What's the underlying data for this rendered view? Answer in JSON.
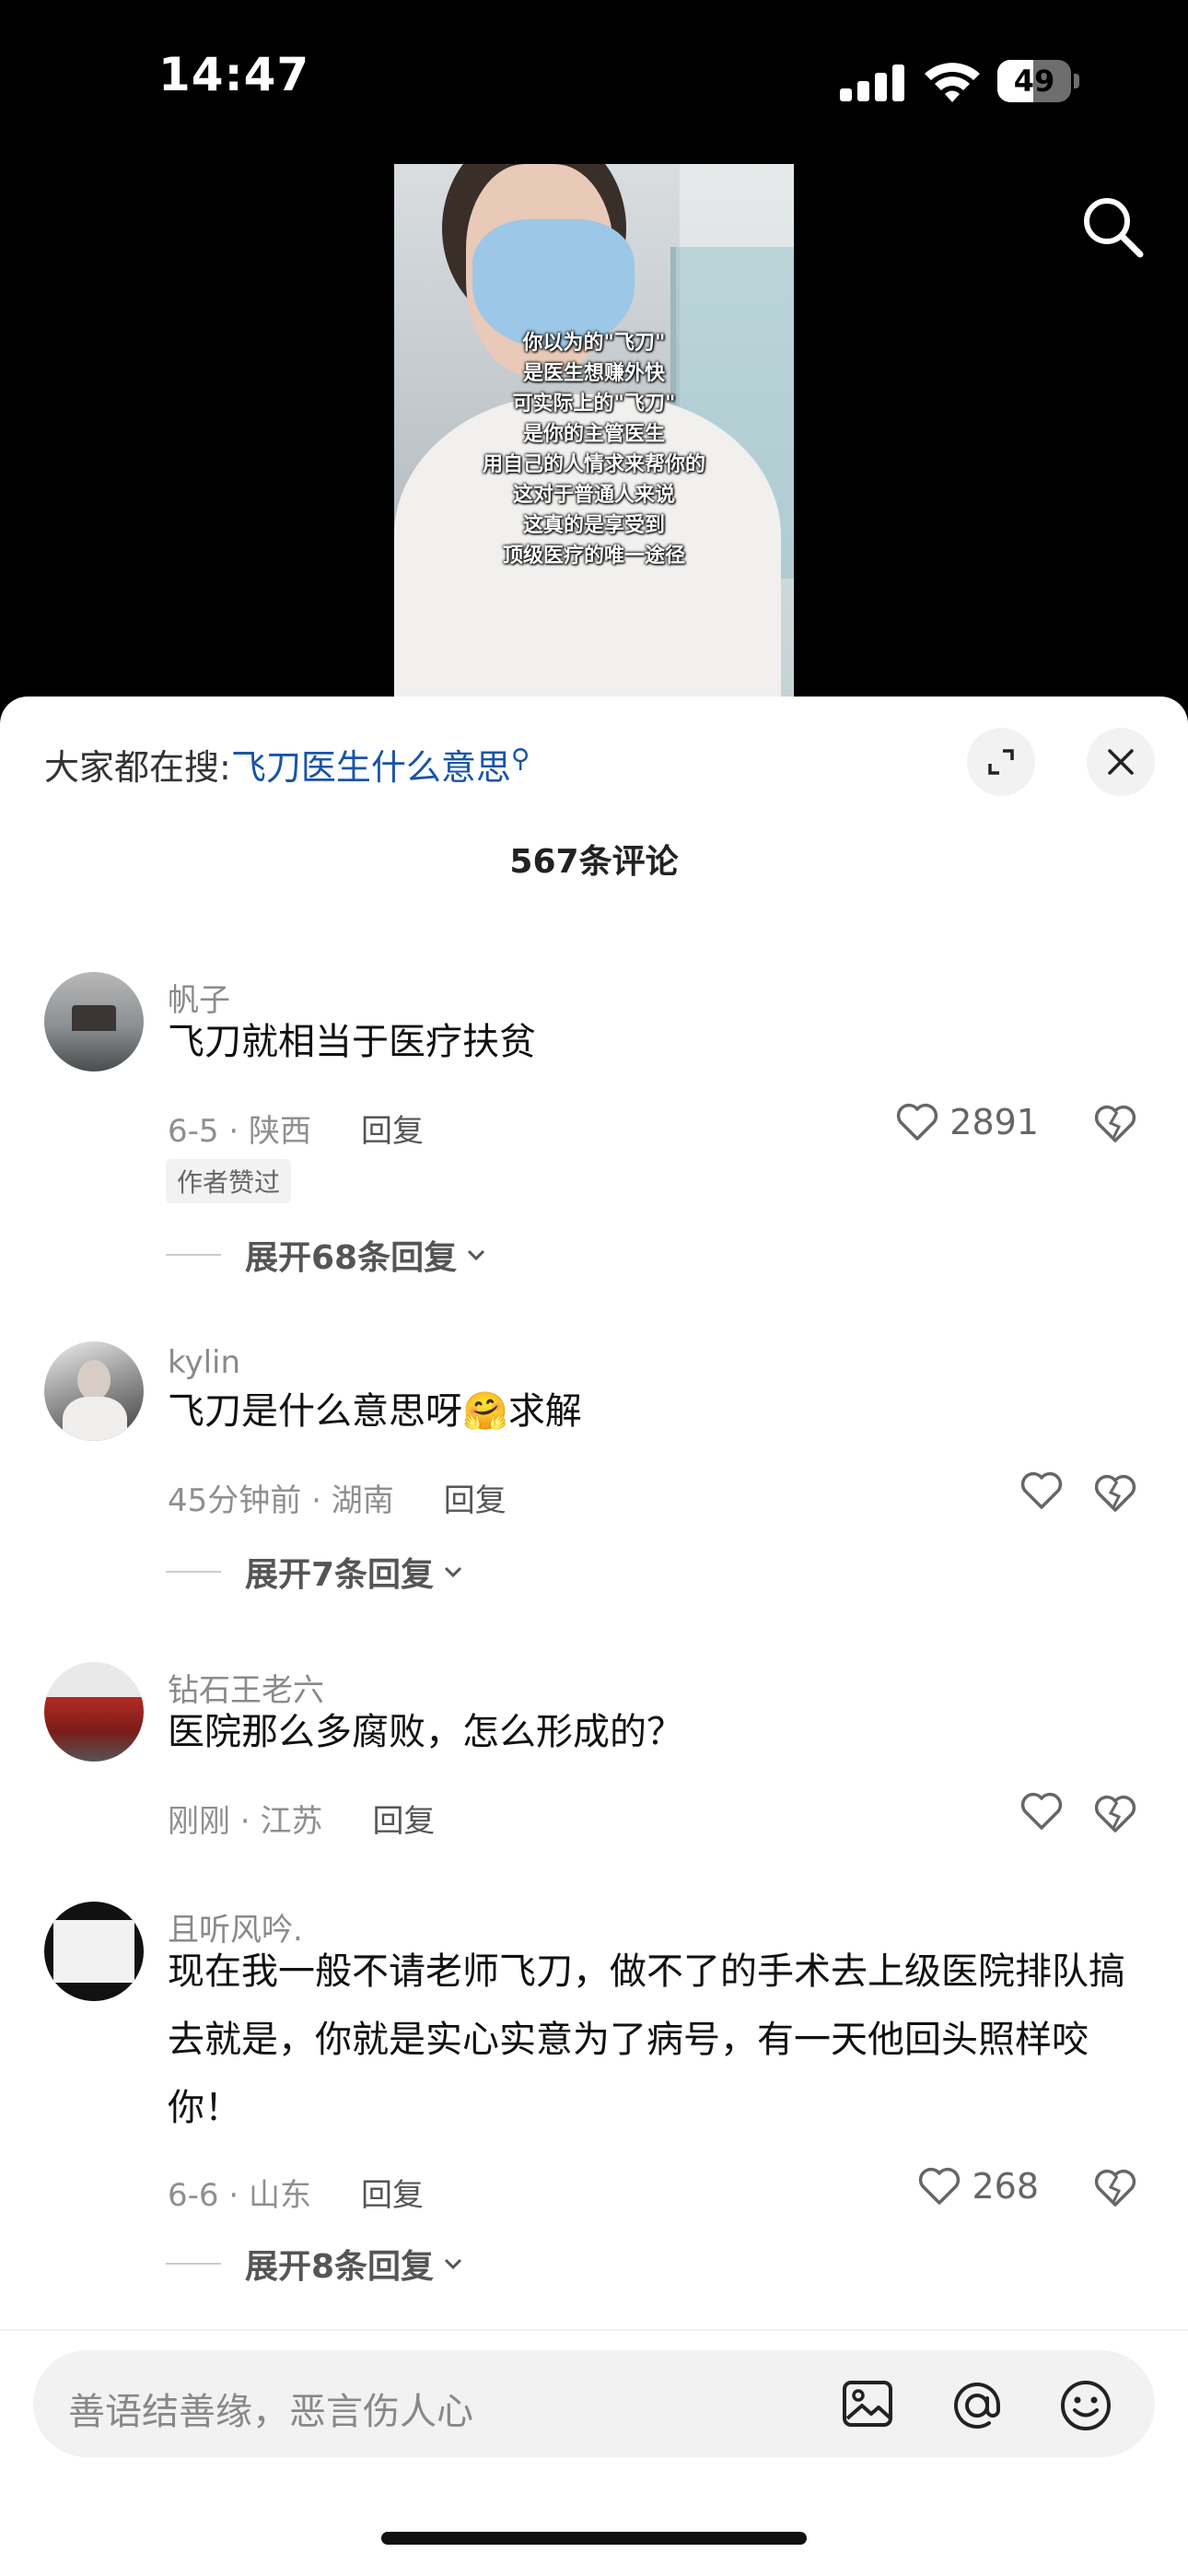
{
  "status_bar": {
    "time": "14:47",
    "battery": "49",
    "battery_level": 0.49
  },
  "video": {
    "caption_lines": [
      "你以为的\"飞刀\"",
      "是医生想赚外快",
      "可实际上的\"飞刀\"",
      "是你的主管医生",
      "用自己的人情求来帮你的",
      "这对于普通人来说",
      "这真的是享受到",
      "顶级医疗的唯一途径"
    ]
  },
  "comments_panel": {
    "hot_search_prefix": "大家都在搜:",
    "hot_search_term": "飞刀医生什么意思",
    "count": "567条评论",
    "comments": [
      {
        "user": "帆子",
        "text": "飞刀就相当于医疗扶贫",
        "date": "6-5",
        "location": "陕西",
        "reply": "回复",
        "likes": "2891",
        "badge": "作者赞过",
        "expand": "展开68条回复"
      },
      {
        "user": "kylin",
        "text_before": "飞刀是什么意思呀",
        "emoji": "🤗",
        "text_after": "求解",
        "date": "45分钟前",
        "location": "湖南",
        "reply": "回复",
        "expand": "展开7条回复"
      },
      {
        "user": "钻石王老六",
        "text": "医院那么多腐败，怎么形成的？",
        "date": "刚刚",
        "location": "江苏",
        "reply": "回复"
      },
      {
        "user": "且听风吟.",
        "text": "现在我一般不请老师飞刀，做不了的手术去上级医院排队搞去就是，你就是实心实意为了病号，有一天他回头照样咬你！",
        "date": "6-6",
        "location": "山东",
        "reply": "回复",
        "likes": "268",
        "expand": "展开8条回复"
      }
    ],
    "input_placeholder": "善语结善缘，恶言伤人心"
  },
  "colors": {
    "link": "#1a54a7",
    "background": "#000000",
    "sheet": "#ffffff"
  },
  "icons": [
    "search-icon",
    "fullscreen-icon",
    "close-icon",
    "heart-icon",
    "dislike-icon",
    "image-icon",
    "at-icon",
    "emoji-icon"
  ]
}
